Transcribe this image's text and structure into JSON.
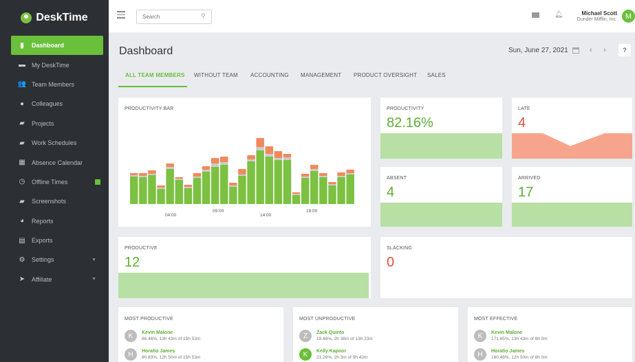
{
  "app": {
    "name": "DeskTime"
  },
  "sidebar": {
    "items": [
      {
        "label": "Dashboard",
        "icon": "bar-chart-icon"
      },
      {
        "label": "My DeskTime",
        "icon": "monitor-icon"
      },
      {
        "label": "Team Members",
        "icon": "people-icon"
      },
      {
        "label": "Colleagues",
        "icon": "user-circle-icon"
      },
      {
        "label": "Projects",
        "icon": "folder-icon"
      },
      {
        "label": "Work Schedules",
        "icon": "briefcase-icon"
      },
      {
        "label": "Absence Calendar",
        "icon": "calendar-icon"
      },
      {
        "label": "Offline Times",
        "icon": "clock-icon"
      },
      {
        "label": "Screenshots",
        "icon": "camera-icon"
      },
      {
        "label": "Reports",
        "icon": "pie-chart-icon"
      },
      {
        "label": "Exports",
        "icon": "export-icon"
      },
      {
        "label": "Settings",
        "icon": "gear-icon"
      },
      {
        "label": "Affiliate",
        "icon": "paper-plane-icon"
      }
    ]
  },
  "header": {
    "search_placeholder": "Search",
    "user_name": "Michael Scott",
    "user_company": "Dunder Mifflin, Inc.",
    "avatar_initial": "M"
  },
  "main": {
    "title": "Dashboard",
    "date": "Sun, June 27, 2021",
    "help": "?",
    "tabs": [
      "ALL TEAM MEMBERS",
      "WITHOUT TEAM",
      "ACCOUNTING",
      "MANAGEMENT",
      "PRODUCT OVERSIGHT",
      "SALES"
    ]
  },
  "cards": {
    "productivity_bar": "PRODUCTIVITY BAR",
    "productivity": {
      "label": "PRODUCTIVITY",
      "value": "82.16%"
    },
    "late": {
      "label": "LATE",
      "value": "4"
    },
    "absent": {
      "label": "ABSENT",
      "value": "4"
    },
    "arrived": {
      "label": "ARRIVED",
      "value": "17"
    },
    "productive": {
      "label": "PRODUCTIVE",
      "value": "12"
    },
    "slacking": {
      "label": "SLACKING",
      "value": "0"
    }
  },
  "lists": {
    "most_productive": {
      "title": "MOST PRODUCTIVE",
      "people": [
        {
          "initial": "K",
          "name": "Kevin Malone",
          "stats": "86.46%, 13h 43m of 15h 53m"
        },
        {
          "initial": "H",
          "name": "Horatio James",
          "stats": "80.83%, 12h 50m of 15h 53m"
        }
      ]
    },
    "most_unproductive": {
      "title": "MOST UNPRODUCTIVE",
      "people": [
        {
          "initial": "Z",
          "name": "Zack Quinto",
          "stats": "19.46%, 2h 36m of 13h 23m"
        },
        {
          "initial": "K",
          "name": "Kelly Kapoor",
          "stats": "21.26%, 2h 3m of 9h 42m"
        }
      ]
    },
    "most_effective": {
      "title": "MOST EFFECTIVE",
      "people": [
        {
          "initial": "K",
          "name": "Kevin Malone",
          "stats": "171.65%, 13h 43m of 8h 0m"
        },
        {
          "initial": "H",
          "name": "Horatio James",
          "stats": "160.48%, 12h 50m of 8h 0m"
        }
      ]
    }
  },
  "chart_data": {
    "type": "bar",
    "x_ticks": [
      "04:00",
      "09:00",
      "14:00",
      "19:00"
    ],
    "series": [
      {
        "name": "productive",
        "color": "#7cc142",
        "values": [
          40,
          39,
          42,
          22,
          51,
          35,
          23,
          38,
          47,
          54,
          57,
          25,
          41,
          62,
          78,
          69,
          64,
          64,
          13,
          38,
          48,
          39,
          27,
          39,
          43
        ]
      },
      {
        "name": "neutral",
        "color": "#cccccc",
        "values": [
          2,
          2,
          2,
          2,
          3,
          2,
          2,
          2,
          3,
          5,
          4,
          2,
          2,
          3,
          5,
          4,
          3,
          4,
          2,
          2,
          3,
          2,
          2,
          2,
          2
        ]
      },
      {
        "name": "unproductive",
        "color": "#f08a5d",
        "values": [
          3,
          4,
          5,
          3,
          5,
          2,
          3,
          5,
          5,
          8,
          8,
          4,
          8,
          6,
          13,
          11,
          10,
          5,
          2,
          4,
          6,
          4,
          3,
          5,
          5
        ]
      }
    ]
  },
  "late_chart": {
    "values": [
      4,
      4,
      2,
      4,
      4
    ]
  }
}
